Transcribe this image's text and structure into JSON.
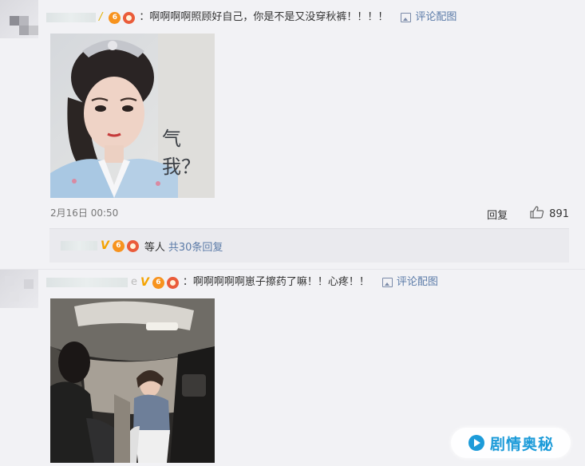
{
  "comments": [
    {
      "text": "：啊啊啊啊照顾好自己，你是不是又没穿秋裤！！！！",
      "pic_link": "评论配图",
      "image_caption": "气我？",
      "date": "2月16日 00:50",
      "reply_label": "回复",
      "like_count": "891",
      "thread": {
        "prefix": "等人",
        "more": "共30条回复"
      }
    },
    {
      "name_tail": "e",
      "text": "：啊啊啊啊啊崽子擦药了嘛！！心疼！！",
      "pic_link": "评论配图"
    }
  ],
  "badges": {
    "vip": "6",
    "v": "V"
  },
  "watermark": {
    "text": "剧情奥秘"
  },
  "colors": {
    "link": "#5b7ba8",
    "brand": "#1c9bd9",
    "background": "#f2f2f5"
  }
}
